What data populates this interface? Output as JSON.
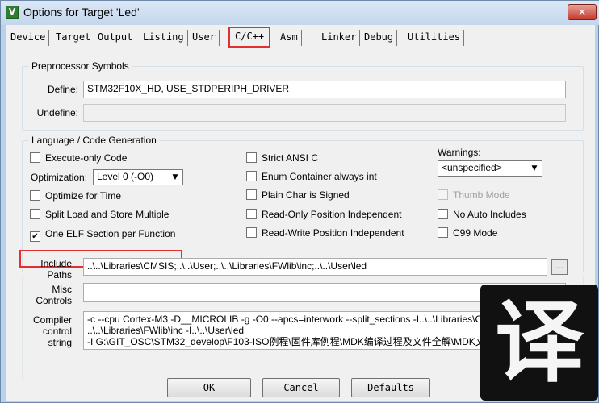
{
  "window": {
    "title": "Options for Target 'Led'",
    "icon": "keil-uvision-icon",
    "close": "✕"
  },
  "tabs": [
    {
      "label": "Device"
    },
    {
      "label": "Target"
    },
    {
      "label": "Output"
    },
    {
      "label": "Listing"
    },
    {
      "label": "User"
    },
    {
      "label": "C/C++",
      "active": true
    },
    {
      "label": "Asm"
    },
    {
      "label": "Linker"
    },
    {
      "label": "Debug"
    },
    {
      "label": "Utilities"
    }
  ],
  "preprocessor": {
    "group_title": "Preprocessor Symbols",
    "define_label": "Define:",
    "define_value": "STM32F10X_HD, USE_STDPERIPH_DRIVER",
    "undefine_label": "Undefine:",
    "undefine_value": ""
  },
  "language": {
    "group_title": "Language / Code Generation",
    "execute_only": {
      "label": "Execute-only Code",
      "checked": false
    },
    "optimization_label": "Optimization:",
    "optimization_value": "Level 0 (-O0)",
    "optimize_time": {
      "label": "Optimize for Time",
      "checked": false
    },
    "split_load": {
      "label": "Split Load and Store Multiple",
      "checked": false
    },
    "one_elf": {
      "label": "One ELF Section per Function",
      "checked": true
    },
    "strict_ansi": {
      "label": "Strict ANSI C",
      "checked": false
    },
    "enum_container": {
      "label": "Enum Container always int",
      "checked": false
    },
    "plain_char": {
      "label": "Plain Char is Signed",
      "checked": false
    },
    "ro_position": {
      "label": "Read-Only Position Independent",
      "checked": false
    },
    "rw_position": {
      "label": "Read-Write Position Independent",
      "checked": false
    },
    "warnings_label": "Warnings:",
    "warnings_value": "<unspecified>",
    "thumb_mode": {
      "label": "Thumb Mode",
      "checked": false,
      "disabled": true
    },
    "no_auto_includes": {
      "label": "No Auto Includes",
      "checked": false
    },
    "c99_mode": {
      "label": "C99 Mode",
      "checked": false
    }
  },
  "include_paths": {
    "label_line1": "Include",
    "label_line2": "Paths",
    "value": "..\\..\\Libraries\\CMSIS;..\\..\\User;..\\..\\Libraries\\FWlib\\inc;..\\..\\User\\led",
    "browse": "..."
  },
  "misc_controls": {
    "label_line1": "Misc",
    "label_line2": "Controls",
    "value": ""
  },
  "compiler_control": {
    "label_line1": "Compiler",
    "label_line2": "control",
    "label_line3": "string",
    "line1": "-c --cpu Cortex-M3 -D__MICROLIB -g -O0 --apcs=interwork --split_sections -I..\\..\\Libraries\\CMSIS -I..\\..\\User -I",
    "line2": "..\\..\\Libraries\\FWlib\\inc -I..\\..\\User\\led",
    "line3": "-I G:\\GIT_OSC\\STM32_develop\\F103-ISO例程\\固件库例程\\MDK编译过程及文件全解\\MDK文件详解"
  },
  "buttons": {
    "ok": "OK",
    "cancel": "Cancel",
    "defaults": "Defaults"
  },
  "watermark": {
    "glyph": "译"
  },
  "colors": {
    "highlight": "#e03030",
    "window_frame": "#b9d1ea",
    "dialog_bg": "#f0f0f0"
  }
}
